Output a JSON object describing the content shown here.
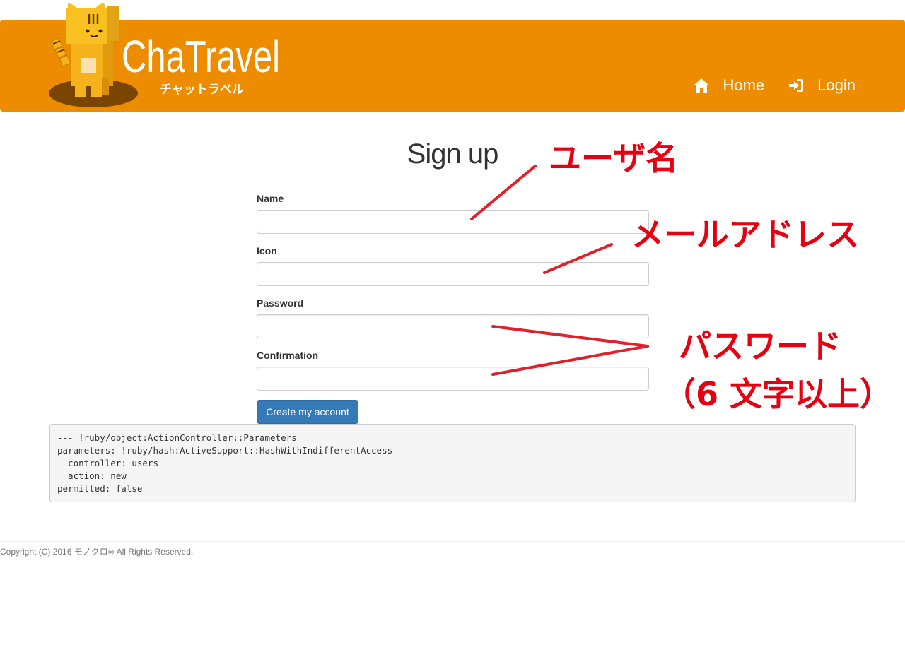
{
  "header": {
    "logo_text": "ChaTravel",
    "logo_subtext": "チャットラベル",
    "nav": [
      {
        "label": "Home",
        "icon": "home-icon"
      },
      {
        "label": "Login",
        "icon": "login-icon"
      }
    ],
    "bg_color": "#ee8c00"
  },
  "main": {
    "title": "Sign up",
    "fields": [
      {
        "label": "Name",
        "value": ""
      },
      {
        "label": "Icon",
        "value": ""
      },
      {
        "label": "Password",
        "value": ""
      },
      {
        "label": "Confirmation",
        "value": ""
      }
    ],
    "submit_label": "Create my account"
  },
  "debug_output": "--- !ruby/object:ActionController::Parameters\nparameters: !ruby/hash:ActiveSupport::HashWithIndifferentAccess\n  controller: users\n  action: new\npermitted: false",
  "footer": {
    "copyright": "Copyright (C) 2016 モノクロ∞ All Rights Reserved."
  },
  "annotations": {
    "name": "ユーザ名",
    "email": "メールアドレス",
    "password": "パスワード",
    "password_rule": "（6 文字以上）",
    "color": "#e50012"
  }
}
